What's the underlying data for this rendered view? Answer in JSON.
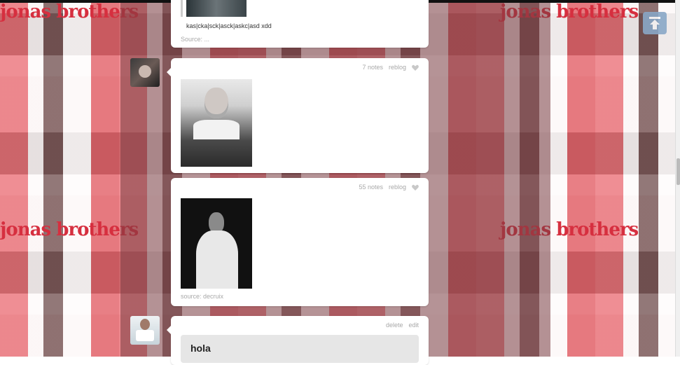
{
  "wallpaper": {
    "brand_text": "jonas brothers",
    "colors": {
      "red": "#d62f3f",
      "dim_overlay": "#784146"
    }
  },
  "scroll_to_top": {
    "icon": "arrow-up-bar-icon"
  },
  "posts": [
    {
      "caption": "kas|cka|sck|asck|askc|asd xdd",
      "source": "Source: ..."
    },
    {
      "notes": "7 notes",
      "reblog": "reblog",
      "like_icon": "heart-icon"
    },
    {
      "notes": "55 notes",
      "reblog": "reblog",
      "like_icon": "heart-icon",
      "source": "source: decruix"
    },
    {
      "delete": "delete",
      "edit": "edit",
      "text": "hola"
    }
  ]
}
